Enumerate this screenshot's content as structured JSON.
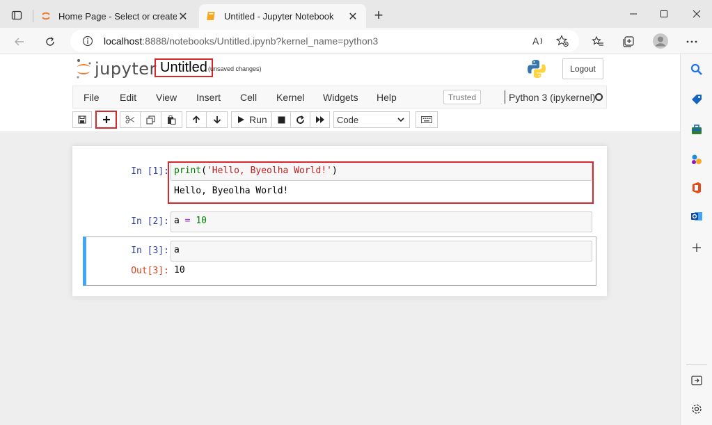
{
  "browser": {
    "tabs": [
      {
        "title": "Home Page - Select or create a notebook",
        "active": false
      },
      {
        "title": "Untitled - Jupyter Notebook",
        "active": true
      }
    ],
    "url_host": "localhost",
    "url_rest": ":8888/notebooks/Untitled.ipynb?kernel_name=python3"
  },
  "jupyter": {
    "logo_text": "jupyter",
    "notebook_title": "Untitled",
    "save_status": "(unsaved changes)",
    "logout_label": "Logout",
    "menu": [
      "File",
      "Edit",
      "View",
      "Insert",
      "Cell",
      "Kernel",
      "Widgets",
      "Help"
    ],
    "trusted_label": "Trusted",
    "kernel_name": "Python 3 (ipykernel)",
    "toolbar": {
      "run_label": "Run",
      "cell_type": "Code"
    }
  },
  "cells": [
    {
      "in_prompt": "In [1]:",
      "code": {
        "fn": "print",
        "open": "(",
        "str": "'Hello, Byeolha World!'",
        "close": ")"
      },
      "output": "Hello, Byeolha World!"
    },
    {
      "in_prompt": "In [2]:",
      "code": {
        "var": "a",
        "op": "=",
        "num": "10"
      }
    },
    {
      "in_prompt": "In [3]:",
      "code": {
        "var": "a"
      },
      "out_prompt": "Out[3]:",
      "output": "10"
    }
  ],
  "colors": {
    "accent_red": "#d9262c",
    "selected_cell_bar": "#42a5f5",
    "jupyter_orange": "#f37726"
  }
}
